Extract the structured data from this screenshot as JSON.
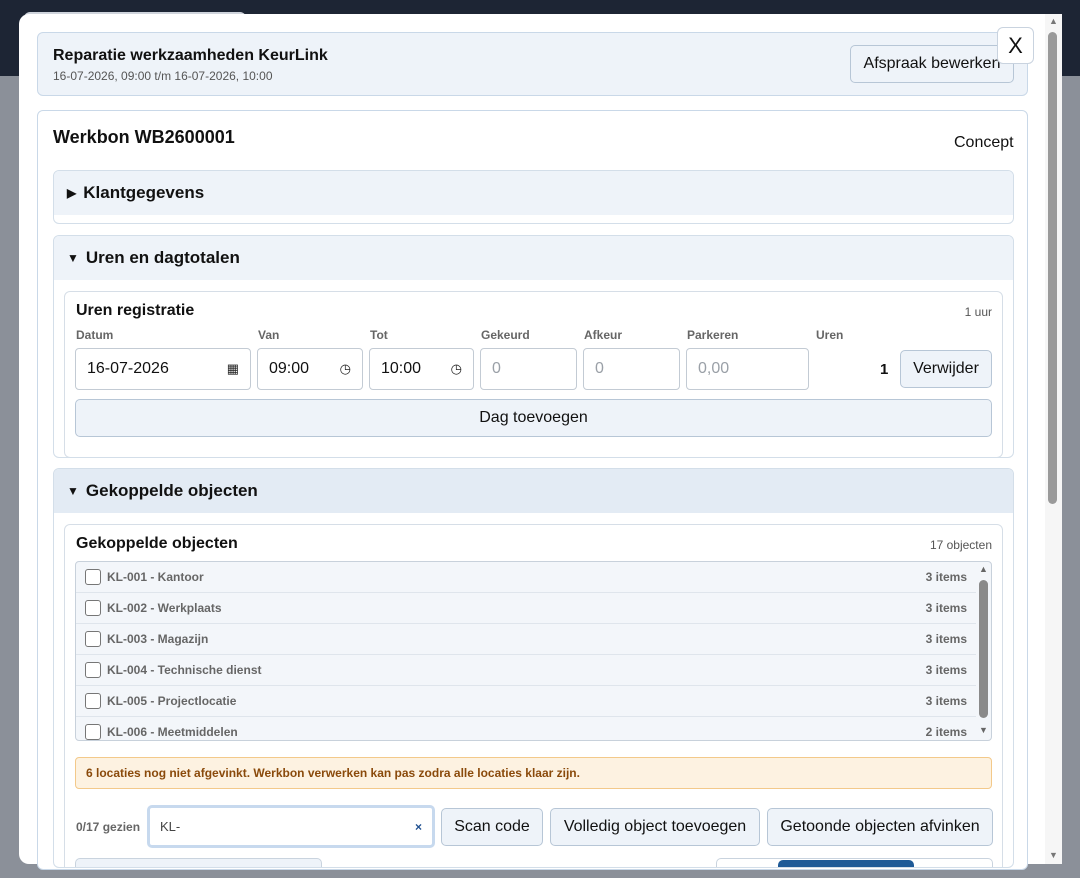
{
  "appointment": {
    "title": "Reparatie werkzaamheden KeurLink",
    "datetime": "16-07-2026, 09:00 t/m 16-07-2026, 10:00",
    "edit_label": "Afspraak bewerken"
  },
  "modal": {
    "close_label": "X"
  },
  "workorder": {
    "title": "Werkbon WB2600001",
    "status": "Concept"
  },
  "sections": {
    "klant": {
      "label": "Klantgegevens",
      "icon": "triangle-right-icon"
    },
    "uren": {
      "label": "Uren en dagtotalen",
      "icon": "triangle-down-icon"
    },
    "objecten": {
      "label": "Gekoppelde objecten",
      "icon": "triangle-down-icon"
    }
  },
  "hours": {
    "title": "Uren registratie",
    "count": "1 uur",
    "columns": {
      "datum": "Datum",
      "van": "Van",
      "tot": "Tot",
      "gekeurd": "Gekeurd",
      "afkeur": "Afkeur",
      "parkeren": "Parkeren",
      "uren": "Uren"
    },
    "row": {
      "datum": "16-07-2026",
      "van": "09:00",
      "tot": "10:00",
      "gekeurd_placeholder": "0",
      "afkeur_placeholder": "0",
      "parkeren_placeholder": "0,00",
      "uren": "1"
    },
    "delete_label": "Verwijder",
    "add_day_label": "Dag toevoegen"
  },
  "objects": {
    "title": "Gekoppelde objecten",
    "count": "17 objecten",
    "items": [
      {
        "label": "KL-001 - Kantoor",
        "items": "3 items"
      },
      {
        "label": "KL-002 - Werkplaats",
        "items": "3 items"
      },
      {
        "label": "KL-003 - Magazijn",
        "items": "3 items"
      },
      {
        "label": "KL-004 - Technische dienst",
        "items": "3 items"
      },
      {
        "label": "KL-005 - Projectlocatie",
        "items": "3 items"
      },
      {
        "label": "KL-006 - Meetmiddelen",
        "items": "2 items"
      }
    ],
    "warning": "6 locaties nog niet afgevinkt. Werkbon verwerken kan pas zodra alle locaties klaar zijn.",
    "seen": "0/17 gezien",
    "search_value": "KL-",
    "clear_label": "×",
    "scan_label": "Scan code",
    "add_full_label": "Volledig object toevoegen",
    "check_shown_label": "Getoonde objecten afvinken"
  },
  "colors": {
    "overlay": "#8b9099",
    "header_bg": "#1d2534",
    "accent": "#1e5a97",
    "panel_bg": "#eef3f9",
    "warning_bg": "#fdf2e1",
    "warning_text": "#8a4a0b"
  }
}
